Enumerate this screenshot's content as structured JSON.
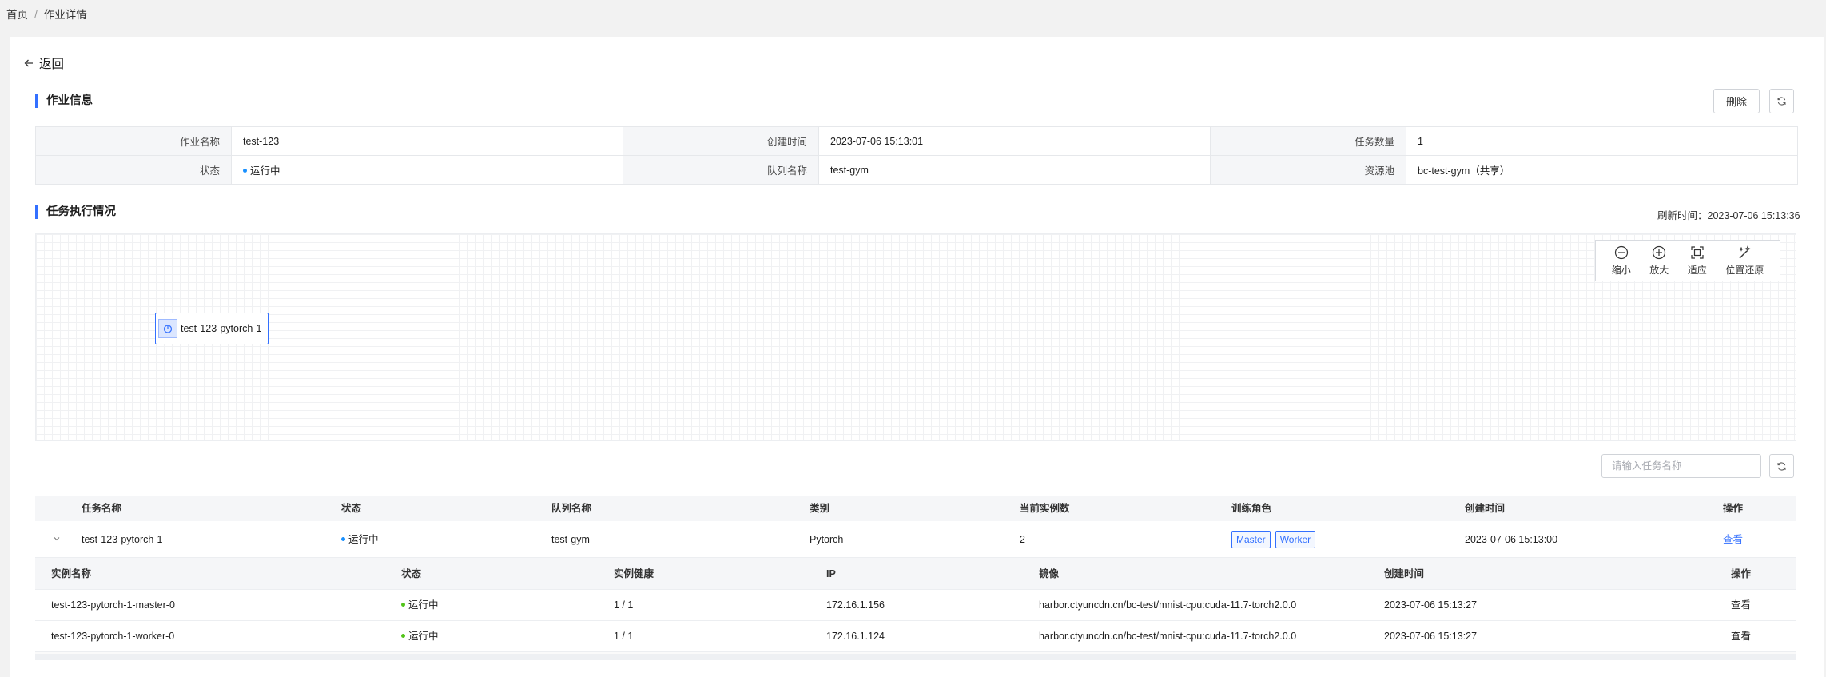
{
  "breadcrumb": {
    "home": "首页",
    "separator": "/",
    "current": "作业详情"
  },
  "back_label": "返回",
  "job_section": {
    "title": "作业信息",
    "delete_label": "删除",
    "fields": {
      "name_label": "作业名称",
      "name_value": "test-123",
      "created_label": "创建时间",
      "created_value": "2023-07-06 15:13:01",
      "task_count_label": "任务数量",
      "task_count_value": "1",
      "status_label": "状态",
      "status_value": "运行中",
      "queue_label": "队列名称",
      "queue_value": "test-gym",
      "pool_label": "资源池",
      "pool_value": "bc-test-gym（共享）"
    }
  },
  "exec_section": {
    "title": "任务执行情况",
    "refresh_label": "刷新时间：",
    "refresh_time": "2023-07-06 15:13:36"
  },
  "graph": {
    "node_label": "test-123-pytorch-1",
    "tools": {
      "zoom_out": "缩小",
      "zoom_in": "放大",
      "fit": "适应",
      "reset": "位置还原"
    }
  },
  "search": {
    "placeholder": "请输入任务名称"
  },
  "task_table": {
    "headers": [
      "任务名称",
      "状态",
      "队列名称",
      "类别",
      "当前实例数",
      "训练角色",
      "创建时间",
      "操作"
    ],
    "rows": [
      {
        "name": "test-123-pytorch-1",
        "status": "运行中",
        "queue": "test-gym",
        "type": "Pytorch",
        "instances": "2",
        "roles": [
          "Master",
          "Worker"
        ],
        "created": "2023-07-06 15:13:00",
        "action": "查看"
      }
    ]
  },
  "instance_table": {
    "headers": [
      "实例名称",
      "状态",
      "实例健康",
      "IP",
      "镜像",
      "创建时间",
      "操作"
    ],
    "rows": [
      {
        "name": "test-123-pytorch-1-master-0",
        "status": "运行中",
        "health": "1 / 1",
        "ip": "172.16.1.156",
        "image": "harbor.ctyuncdn.cn/bc-test/mnist-cpu:cuda-11.7-torch2.0.0",
        "created": "2023-07-06 15:13:27",
        "action": "查看"
      },
      {
        "name": "test-123-pytorch-1-worker-0",
        "status": "运行中",
        "health": "1 / 1",
        "ip": "172.16.1.124",
        "image": "harbor.ctyuncdn.cn/bc-test/mnist-cpu:cuda-11.7-torch2.0.0",
        "created": "2023-07-06 15:13:27",
        "action": "查看"
      }
    ]
  },
  "colors": {
    "accent": "#3370ff",
    "status_running_blue": "#1890ff",
    "status_running_green": "#52c41a"
  }
}
